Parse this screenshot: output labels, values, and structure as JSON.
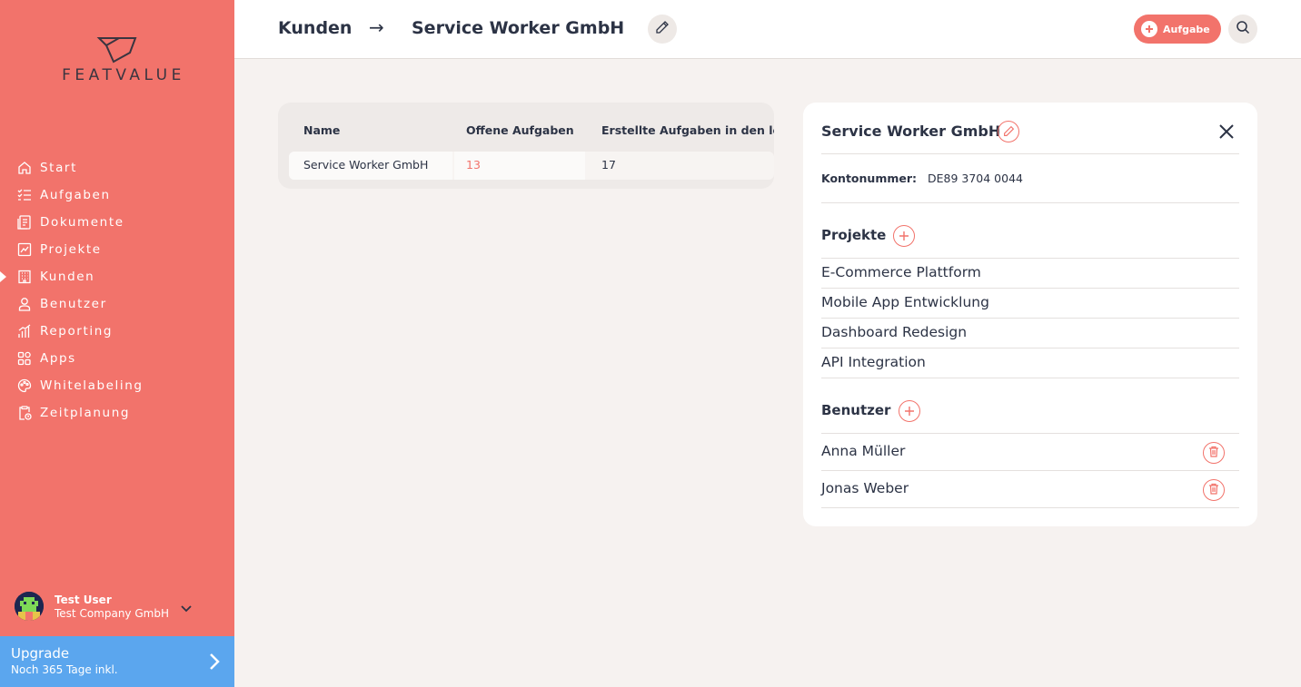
{
  "brand": {
    "name": "FEATVALUE",
    "accent": "#f2736b",
    "upgrade_color": "#5ba6ee"
  },
  "sidebar": {
    "items": [
      {
        "label": "Start",
        "icon": "home-icon"
      },
      {
        "label": "Aufgaben",
        "icon": "checklist-icon"
      },
      {
        "label": "Dokumente",
        "icon": "document-icon"
      },
      {
        "label": "Projekte",
        "icon": "chart-icon"
      },
      {
        "label": "Kunden",
        "icon": "building-icon",
        "active": true
      },
      {
        "label": "Benutzer",
        "icon": "user-icon"
      },
      {
        "label": "Reporting",
        "icon": "bar-chart-icon"
      },
      {
        "label": "Apps",
        "icon": "apps-icon"
      },
      {
        "label": "Whitelabeling",
        "icon": "palette-icon"
      },
      {
        "label": "Zeitplanung",
        "icon": "clipboard-clock-icon"
      }
    ],
    "user": {
      "name": "Test User",
      "company": "Test Company GmbH"
    },
    "upgrade": {
      "title": "Upgrade",
      "subtitle": "Noch 365 Tage inkl."
    }
  },
  "header": {
    "breadcrumb_parent": "Kunden",
    "breadcrumb_arrow": "→",
    "breadcrumb_current": "Service Worker GmbH",
    "task_button": "Aufgabe"
  },
  "table": {
    "columns": [
      "Name",
      "Offene Aufgaben",
      "Erstellte Aufgaben in den le"
    ],
    "rows": [
      {
        "name": "Service Worker GmbH",
        "open": "13",
        "created": "17"
      }
    ]
  },
  "panel": {
    "title": "Service Worker GmbH",
    "account_label": "Kontonummer:",
    "account_value": "DE89 3704 0044",
    "projects_title": "Projekte",
    "projects": [
      "E-Commerce Plattform",
      "Mobile App Entwicklung",
      "Dashboard Redesign",
      "API Integration"
    ],
    "users_title": "Benutzer",
    "users": [
      "Anna Müller",
      "Jonas Weber"
    ]
  }
}
